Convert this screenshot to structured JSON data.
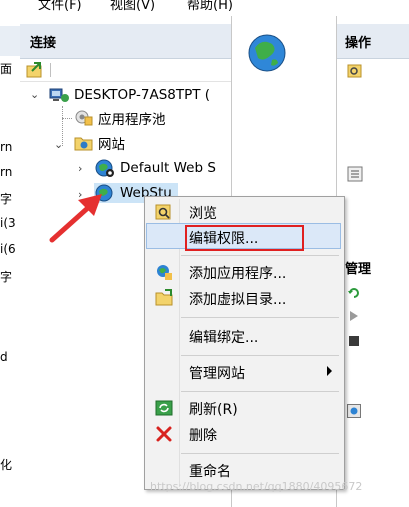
{
  "menubar": {
    "items": [
      "文件(F)",
      "视图(V)",
      "帮助(H)"
    ]
  },
  "left_strip": {
    "texts": [
      "面",
      "rn",
      "rn",
      "字",
      "i(3",
      "i(6",
      "字",
      "d",
      "化"
    ]
  },
  "connections": {
    "title": "连接",
    "tree": {
      "server": "DESKTOP-7AS8TPT (",
      "app_pools": "应用程序池",
      "sites": "网站",
      "site1": "Default Web S",
      "site2": "WebStu"
    }
  },
  "actions": {
    "title": "操作",
    "section": "管理"
  },
  "context_menu": {
    "items": [
      {
        "label": "浏览",
        "icon": "browse-icon"
      },
      {
        "label": "编辑权限...",
        "icon": ""
      },
      {
        "label": "添加应用程序...",
        "icon": "add-application-icon"
      },
      {
        "label": "添加虚拟目录...",
        "icon": "add-virtual-dir-icon"
      },
      {
        "label": "编辑绑定...",
        "icon": ""
      },
      {
        "label": "管理网站",
        "icon": "",
        "submenu": true
      },
      {
        "label": "刷新(R)",
        "icon": "refresh-icon"
      },
      {
        "label": "删除",
        "icon": "delete-icon"
      },
      {
        "label": "重命名",
        "icon": ""
      }
    ]
  },
  "colors": {
    "highlight_border": "#e02020",
    "panel_header": "#e5ebf3",
    "annotation_arrow": "#e53030"
  },
  "watermark": "https://blog.csdn.net/qq1880/4095672"
}
